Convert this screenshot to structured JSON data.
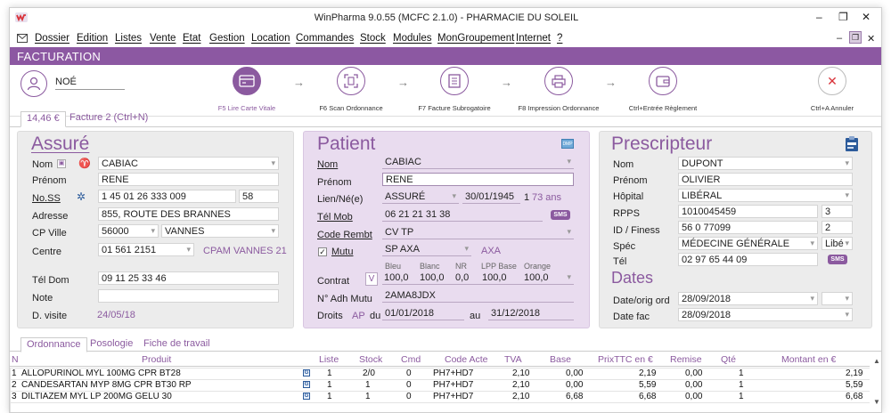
{
  "window": {
    "title": "WinPharma 9.0.55  (MCFC 2.1.0) - PHARMACIE DU SOLEIL",
    "minimize": "–",
    "restore": "❐",
    "close": "✕"
  },
  "menu": [
    "Dossier",
    "Edition",
    "Listes",
    "Vente",
    "Etat",
    "Gestion",
    "Location",
    "Commandes",
    "Stock",
    "Modules",
    "MonGroupement",
    "Internet",
    "?"
  ],
  "section_title": "FACTURATION",
  "patient_short": "NOÉ",
  "workflow": {
    "steps": [
      {
        "label": "F5 Lire Carte Vitale",
        "active": true
      },
      {
        "label": "F6 Scan Ordonnance"
      },
      {
        "label": "F7 Facture Subrogatoire"
      },
      {
        "label": "F8 Impression Ordonnance"
      },
      {
        "label": "Ctrl+Entrée Règlement"
      }
    ],
    "cancel_label": "Ctrl+A Annuler"
  },
  "invoice_tabs": {
    "amount": "14,46 €",
    "facture2": "Facture 2 (Ctrl+N)"
  },
  "assure": {
    "title": "Assuré",
    "labels": {
      "nom": "Nom",
      "prenom": "Prénom",
      "noss": "No.SS",
      "adresse": "Adresse",
      "cpville": "CP Ville",
      "centre": "Centre",
      "teldom": "Tél Dom",
      "note": "Note",
      "dvisite": "D. visite"
    },
    "nom": "CABIAC",
    "prenom": "RENE",
    "noss": "1 45 01 26 333 009",
    "noss_key": "58",
    "adresse": "855, ROUTE DES BRANNES",
    "cp": "56000",
    "ville": "VANNES",
    "centre": "01 561 2151",
    "centre_name": "CPAM VANNES 21",
    "teldom": "09 11 25 33 46",
    "note": "",
    "dvisite": "24/05/18"
  },
  "patient": {
    "title": "Patient",
    "labels": {
      "nom": "Nom",
      "prenom": "Prénom",
      "lien": "Lien/Né(e)",
      "telmob": "Tél Mob",
      "code": "Code Rembt",
      "mutu": "Mutu",
      "contrat": "Contrat",
      "adh": "N° Adh Mutu",
      "droits": "Droits",
      "du": "du",
      "au": "au"
    },
    "nom": "CABIAC",
    "prenom": "RENE",
    "lien": "ASSURÉ",
    "dob": "30/01/1945",
    "rang": "1",
    "age": "73 ans",
    "telmob": "06 21 21 31 38",
    "sms": "SMS",
    "code": "CV TP",
    "mutu": "SP AXA",
    "mutu_name": "AXA",
    "contrat_headers": [
      "Bleu",
      "Blanc",
      "NR",
      "LPP Base",
      "Orange"
    ],
    "contrat_values": [
      "100,0",
      "100,0",
      "0,0",
      "100,0",
      "100,0"
    ],
    "contrat_v": "V",
    "adh": "2AMA8JDX",
    "droits_ap": "AP",
    "droits_du": "01/01/2018",
    "droits_au": "31/12/2018",
    "dmp": "DMP"
  },
  "prescripteur": {
    "title": "Prescripteur",
    "labels": {
      "nom": "Nom",
      "prenom": "Prénom",
      "hopital": "Hôpital",
      "rpps": "RPPS",
      "finess": "ID / Finess",
      "spec": "Spéc",
      "tel": "Tél"
    },
    "nom": "DUPONT",
    "prenom": "OLIVIER",
    "hopital": "LIBÉRAL",
    "rpps": "1010045459",
    "rpps_n": "3",
    "finess": "56 0 77099",
    "finess_n": "2",
    "spec": "MÉDECINE GÉNÉRALE",
    "spec_type": "Libé",
    "tel": "02 97 65 44 09",
    "sms": "SMS",
    "dates_title": "Dates",
    "dates_labels": {
      "orig": "Date/orig ord",
      "fac": "Date fac"
    },
    "date_orig": "28/09/2018",
    "date_fac": "28/09/2018"
  },
  "bottom_tabs": [
    "Ordonnance",
    "Posologie",
    "Fiche de travail"
  ],
  "grid": {
    "headers": [
      "N",
      "Produit",
      "Liste",
      "Stock",
      "Cmd",
      "Code Acte",
      "TVA",
      "Base",
      "PrixTTC en €",
      "Remise",
      "Qté",
      "Montant en €"
    ],
    "rows": [
      [
        "1",
        "ALLOPURINOL MYL 100MG CPR BT28",
        "1",
        "2/0",
        "0",
        "PH7+HD7",
        "2,10",
        "0,00",
        "2,19",
        "0,00",
        "1",
        "2,19"
      ],
      [
        "2",
        "CANDESARTAN MYP 8MG CPR BT30 RP",
        "1",
        "1",
        "0",
        "PH7+HD7",
        "2,10",
        "0,00",
        "5,59",
        "0,00",
        "1",
        "5,59"
      ],
      [
        "3",
        "DILTIAZEM MYL LP 200MG GELU 30",
        "1",
        "1",
        "0",
        "PH7+HD7",
        "2,10",
        "6,68",
        "6,68",
        "0,00",
        "1",
        "6,68"
      ]
    ],
    "generic_badge": "G"
  },
  "colors": {
    "accent": "#8b5a9f",
    "bar": "#8c58a2",
    "panel_grey": "#ececec",
    "panel_purple": "#e9dcef",
    "cancel": "#d9343b"
  }
}
